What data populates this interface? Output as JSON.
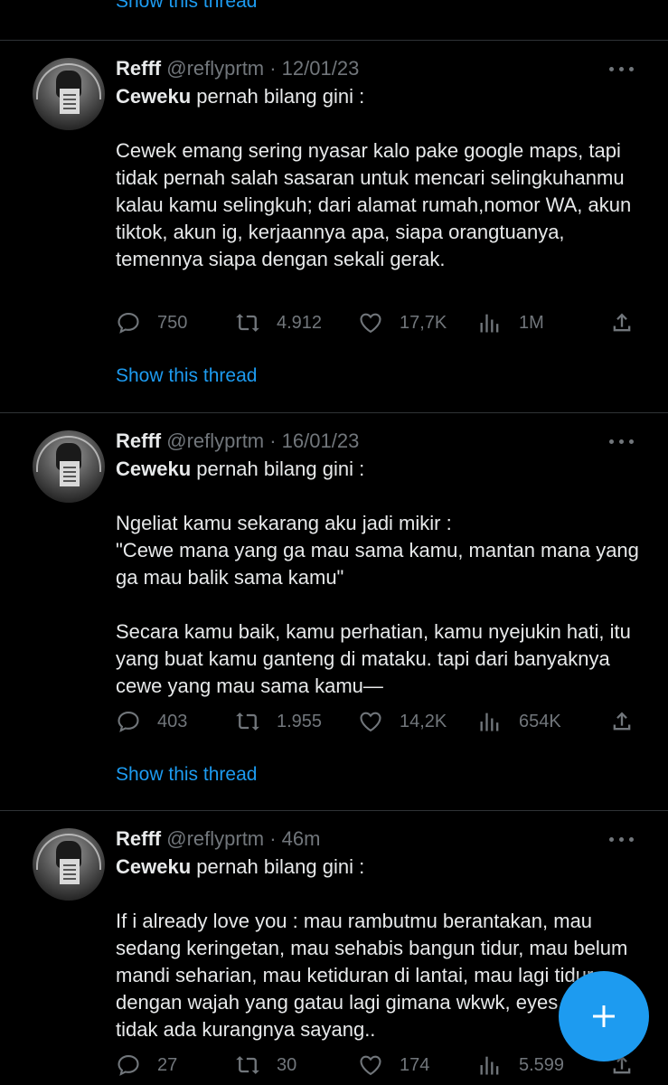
{
  "top_show_thread": "Show this thread",
  "tweets": [
    {
      "name": "Refff",
      "meta": "@reflyprtm · 12/01/23",
      "lead_bold": "Ceweku",
      "lead_rest": " pernah bilang gini :",
      "paragraphs": [
        "Cewek emang sering nyasar kalo pake google maps, tapi tidak pernah salah sasaran untuk mencari selingkuhanmu kalau kamu selingkuh; dari alamat rumah,nomor WA, akun tiktok, akun ig, kerjaannya apa, siapa orangtuanya, temennya siapa dengan sekali gerak."
      ],
      "replies": "750",
      "retweets": "4.912",
      "likes": "17,7K",
      "views": "1M",
      "show_thread": "Show this thread"
    },
    {
      "name": "Refff",
      "meta": "@reflyprtm · 16/01/23",
      "lead_bold": "Ceweku",
      "lead_rest": " pernah bilang gini :",
      "paragraphs": [
        "Ngeliat kamu sekarang aku jadi mikir :",
        "\"Cewe mana yang ga mau sama kamu, mantan mana yang ga mau balik sama kamu\"",
        "Secara kamu baik, kamu perhatian, kamu nyejukin hati, itu yang buat kamu ganteng di mataku. tapi dari banyaknya cewe yang mau sama kamu—"
      ],
      "replies": "403",
      "retweets": "1.955",
      "likes": "14,2K",
      "views": "654K",
      "show_thread": "Show this thread"
    },
    {
      "name": "Refff",
      "meta": "@reflyprtm · 46m",
      "lead_bold": "Ceweku",
      "lead_rest": " pernah bilang gini :",
      "paragraphs": [
        "If i already love you : mau rambutmu berantakan, mau sedang keringetan, mau sehabis bangun tidur, mau belum mandi seharian, mau ketiduran di lantai, mau lagi tidur dengan wajah yang gatau lagi gimana wkwk, eyes, kamu tidak ada kurangnya sayang.."
      ],
      "replies": "27",
      "retweets": "30",
      "likes": "174",
      "views": "5.599"
    }
  ],
  "colors": {
    "background": "#000000",
    "text": "#e7e9ea",
    "muted": "#71767b",
    "accent": "#1d9bf0",
    "divider": "#2f3336"
  },
  "icons": [
    "reply-icon",
    "retweet-icon",
    "like-icon",
    "views-icon",
    "share-icon",
    "more-icon",
    "compose-icon"
  ]
}
